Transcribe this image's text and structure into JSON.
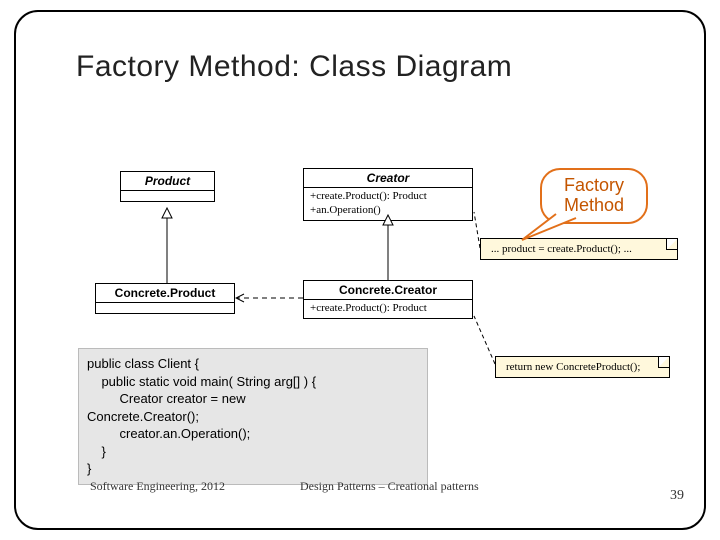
{
  "title": "Factory Method: Class Diagram",
  "callout": {
    "line1": "Factory",
    "line2": "Method"
  },
  "uml": {
    "product": {
      "name": "Product"
    },
    "creator": {
      "name": "Creator",
      "op1": "+create.Product(): Product",
      "op2": "+an.Operation()"
    },
    "concreteProduct": {
      "name": "Concrete.Product"
    },
    "concreteCreator": {
      "name": "Concrete.Creator",
      "op1": "+create.Product(): Product"
    }
  },
  "notes": {
    "opNote": "... product = create.Product(); ...",
    "cpNote": "return new ConcreteProduct();"
  },
  "code": "public class Client {\n    public static void main( String arg[] ) {\n         Creator creator = new\nConcrete.Creator();\n         creator.an.Operation();\n    }\n}",
  "footer": {
    "left": "Software Engineering, 2012",
    "center": "Design Patterns – Creational patterns",
    "page": "39"
  }
}
